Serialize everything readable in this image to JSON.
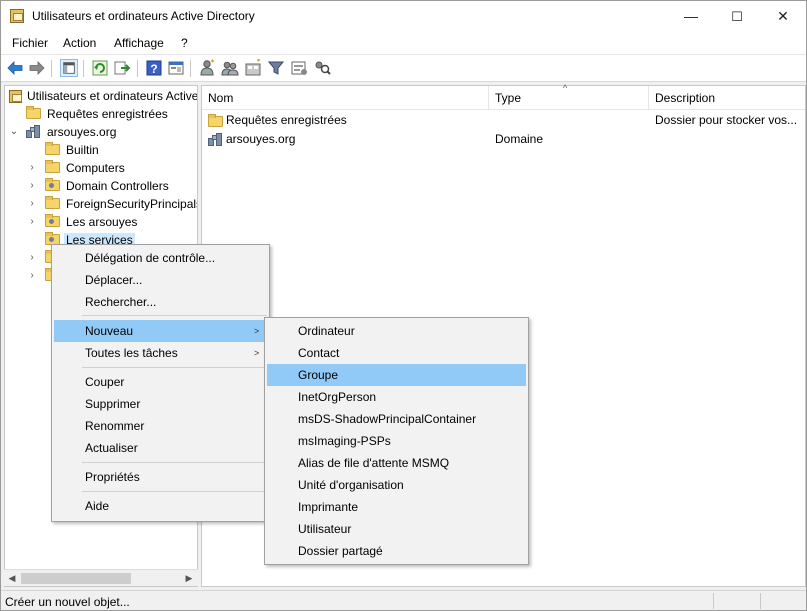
{
  "window": {
    "title": "Utilisateurs et ordinateurs Active Directory",
    "minimize": "—",
    "maximize": "☐",
    "close": "✕"
  },
  "menubar": [
    "Fichier",
    "Action",
    "Affichage",
    "?"
  ],
  "toolbar_icons": [
    "back-icon",
    "forward-icon",
    "show-hide-tree-icon",
    "refresh-icon",
    "export-list-icon",
    "help-icon",
    "properties-icon",
    "new-user-icon",
    "new-group-icon",
    "new-ou-icon",
    "filter-icon",
    "add-to-group-icon",
    "find-icon"
  ],
  "tree": {
    "root": "Utilisateurs et ordinateurs Active Directory",
    "saved_queries": "Requêtes enregistrées",
    "domain": "arsouyes.org",
    "children": [
      "Builtin",
      "Computers",
      "Domain Controllers",
      "ForeignSecurityPrincipals",
      "Les arsouyes",
      "Les services"
    ]
  },
  "list": {
    "columns": [
      "Nom",
      "Type",
      "Description"
    ],
    "rows": [
      {
        "name": "Requêtes enregistrées",
        "type": "",
        "description": "Dossier pour stocker vos..."
      },
      {
        "name": "arsouyes.org",
        "type": "Domaine",
        "description": ""
      }
    ]
  },
  "context_menu": {
    "items": [
      "Délégation de contrôle...",
      "Déplacer...",
      "Rechercher...",
      "Nouveau",
      "Toutes les tâches",
      "Couper",
      "Supprimer",
      "Renommer",
      "Actualiser",
      "Propriétés",
      "Aide"
    ],
    "highlighted": "Nouveau"
  },
  "submenu": {
    "items": [
      "Ordinateur",
      "Contact",
      "Groupe",
      "InetOrgPerson",
      "msDS-ShadowPrincipalContainer",
      "msImaging-PSPs",
      "Alias de file d'attente MSMQ",
      "Unité d'organisation",
      "Imprimante",
      "Utilisateur",
      "Dossier partagé"
    ],
    "highlighted": "Groupe"
  },
  "status": {
    "text": "Créer un nouvel objet..."
  },
  "colors": {
    "highlight": "#91c9f7",
    "selection": "#cce8ff",
    "folder": "#f5d46a"
  }
}
